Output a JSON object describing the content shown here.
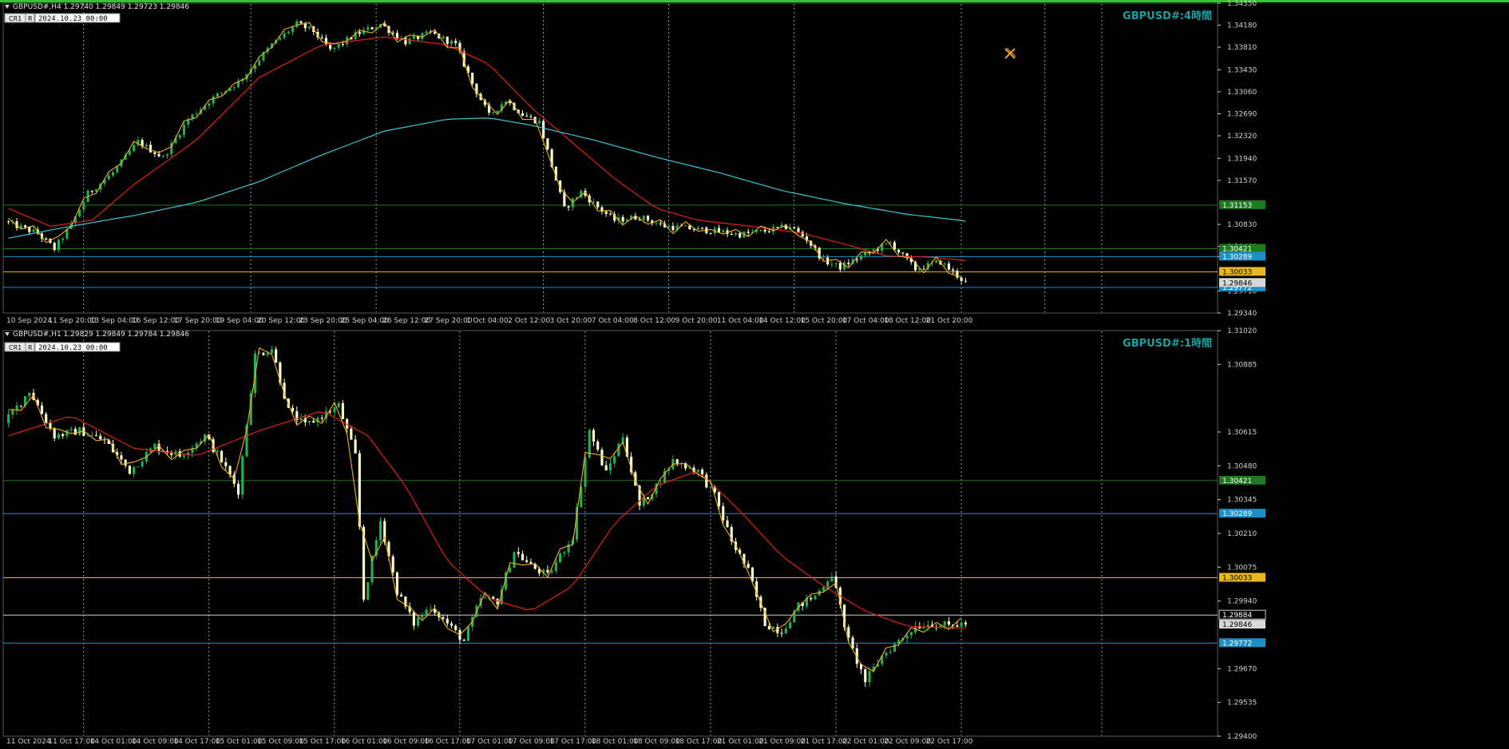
{
  "colors": {
    "background": "#000000",
    "bull": "#22b14c",
    "bear": "#ffffcc",
    "ma_fast": "#e0201a",
    "ma_slow": "#38c8d8",
    "zigzag": "#f0b020",
    "grid": "#c8c8c8",
    "axis_text": "#d0d0d0",
    "watermark": "#1aa0a0",
    "frame_top": "#2ec82e"
  },
  "icons": {
    "cursor": "crosshair-cursor-icon",
    "menu": "triangle-down-icon"
  },
  "chart_data": [
    {
      "type": "candlestick",
      "symbol_header": "GBPUSD#,H4  1.29740 1.29849 1.29723 1.29846",
      "watermark": "GBPUSD#:4時間",
      "toolbar": {
        "cr_label": "CR1",
        "r_label": "R",
        "date_value": "2024.10.23 00:00"
      },
      "ylim": [
        1.2934,
        1.3455
      ],
      "y_ticks": [
        "1.34550",
        "1.34180",
        "1.33810",
        "1.33430",
        "1.33060",
        "1.32690",
        "1.32320",
        "1.31940",
        "1.31570",
        "1.30830",
        "1.30460",
        "1.30289",
        "1.29710",
        "1.29340"
      ],
      "x_tick_labels": [
        "10 Sep 2024",
        "11 Sep 20:00",
        "13 Sep 04:00",
        "16 Sep 12:00",
        "17 Sep 20:00",
        "19 Sep 04:00",
        "20 Sep 12:00",
        "23 Sep 20:00",
        "25 Sep 04:00",
        "26 Sep 12:00",
        "27 Sep 20:00",
        "1 Oct 04:00",
        "2 Oct 12:00",
        "3 Oct 20:00",
        "7 Oct 04:00",
        "8 Oct 12:00",
        "9 Oct 20:00",
        "11 Oct 04:00",
        "14 Oct 12:00",
        "15 Oct 20:00",
        "17 Oct 04:00",
        "18 Oct 12:00",
        "21 Oct 20:00"
      ],
      "vgrid_after_tick": [
        2,
        6,
        9,
        13,
        16,
        19,
        23,
        25
      ],
      "n_bars": 230,
      "close_anchors": [
        [
          0,
          1.3088
        ],
        [
          8,
          1.3068
        ],
        [
          12,
          1.3042
        ],
        [
          16,
          1.3082
        ],
        [
          20,
          1.3135
        ],
        [
          26,
          1.317
        ],
        [
          32,
          1.3222
        ],
        [
          38,
          1.3195
        ],
        [
          44,
          1.326
        ],
        [
          50,
          1.3296
        ],
        [
          56,
          1.3322
        ],
        [
          64,
          1.3385
        ],
        [
          70,
          1.342
        ],
        [
          74,
          1.3408
        ],
        [
          78,
          1.3375
        ],
        [
          84,
          1.3402
        ],
        [
          90,
          1.342
        ],
        [
          96,
          1.339
        ],
        [
          102,
          1.3405
        ],
        [
          108,
          1.3385
        ],
        [
          112,
          1.332
        ],
        [
          116,
          1.3266
        ],
        [
          120,
          1.3292
        ],
        [
          124,
          1.3268
        ],
        [
          128,
          1.3255
        ],
        [
          134,
          1.3109
        ],
        [
          138,
          1.3138
        ],
        [
          142,
          1.3112
        ],
        [
          146,
          1.309
        ],
        [
          152,
          1.3096
        ],
        [
          158,
          1.308
        ],
        [
          164,
          1.3076
        ],
        [
          170,
          1.3072
        ],
        [
          176,
          1.3066
        ],
        [
          182,
          1.3072
        ],
        [
          188,
          1.308
        ],
        [
          192,
          1.3058
        ],
        [
          196,
          1.3022
        ],
        [
          200,
          1.3011
        ],
        [
          206,
          1.3033
        ],
        [
          212,
          1.3052
        ],
        [
          218,
          1.3008
        ],
        [
          224,
          1.302
        ],
        [
          230,
          1.2985
        ]
      ],
      "ma_fast_anchors": [
        [
          0,
          1.311
        ],
        [
          10,
          1.308
        ],
        [
          20,
          1.309
        ],
        [
          30,
          1.315
        ],
        [
          45,
          1.3225
        ],
        [
          60,
          1.333
        ],
        [
          75,
          1.3385
        ],
        [
          90,
          1.3398
        ],
        [
          105,
          1.3385
        ],
        [
          115,
          1.3352
        ],
        [
          125,
          1.328
        ],
        [
          135,
          1.322
        ],
        [
          145,
          1.316
        ],
        [
          155,
          1.311
        ],
        [
          165,
          1.309
        ],
        [
          180,
          1.3078
        ],
        [
          190,
          1.3068
        ],
        [
          200,
          1.305
        ],
        [
          210,
          1.303
        ],
        [
          220,
          1.3028
        ],
        [
          230,
          1.3022
        ]
      ],
      "ma_slow_anchors": [
        [
          0,
          1.306
        ],
        [
          15,
          1.308
        ],
        [
          30,
          1.3098
        ],
        [
          45,
          1.312
        ],
        [
          60,
          1.3155
        ],
        [
          75,
          1.32
        ],
        [
          90,
          1.324
        ],
        [
          105,
          1.326
        ],
        [
          115,
          1.3262
        ],
        [
          125,
          1.325
        ],
        [
          140,
          1.3225
        ],
        [
          155,
          1.3196
        ],
        [
          170,
          1.317
        ],
        [
          185,
          1.314
        ],
        [
          200,
          1.3118
        ],
        [
          215,
          1.31
        ],
        [
          230,
          1.3088
        ]
      ],
      "hlines": [
        {
          "price": 1.31155,
          "color": "#1e7a1e",
          "label": "1.31153",
          "label_bg": "#1e7a1e"
        },
        {
          "price": 1.30421,
          "color": "#1e7a1e",
          "label": "1.30421",
          "label_bg": "#1e7a1e"
        },
        {
          "price": 1.30289,
          "color": "#1e90c8",
          "label": "1.30289",
          "label_bg": "#1e90c8"
        },
        {
          "price": 1.30033,
          "color": "#e8b820",
          "label": "1.30033",
          "label_bg": "#e8b820"
        },
        {
          "price": 1.29772,
          "color": "#1e90c8",
          "label": "1.29772",
          "label_bg": "#1e90c8"
        }
      ],
      "price_labels": [
        {
          "price": 1.29846,
          "label": "1.29846",
          "label_bg": "#d8d8d8"
        }
      ]
    },
    {
      "type": "candlestick",
      "symbol_header": "GBPUSD#,H1  1.29829 1.29849 1.29784 1.29846",
      "watermark": "GBPUSD#:1時間",
      "toolbar": {
        "cr_label": "CR1",
        "r_label": "R",
        "date_value": "2024.10.23 00:00"
      },
      "ylim": [
        1.294,
        1.3102
      ],
      "y_ticks": [
        "1.31020",
        "1.30885",
        "1.30615",
        "1.30480",
        "1.30345",
        "1.30210",
        "1.30075",
        "1.29940",
        "1.29670",
        "1.29535",
        "1.29400"
      ],
      "x_tick_labels": [
        "11 Oct 2024",
        "11 Oct 17:00",
        "14 Oct 01:00",
        "14 Oct 09:00",
        "14 Oct 17:00",
        "15 Oct 01:00",
        "15 Oct 09:00",
        "15 Oct 17:00",
        "16 Oct 01:00",
        "16 Oct 09:00",
        "16 Oct 17:00",
        "17 Oct 01:00",
        "17 Oct 09:00",
        "17 Oct 17:00",
        "18 Oct 01:00",
        "18 Oct 09:00",
        "18 Oct 17:00",
        "21 Oct 01:00",
        "21 Oct 09:00",
        "21 Oct 17:00",
        "22 Oct 01:00",
        "22 Oct 09:00",
        "22 Oct 17:00"
      ],
      "vgrid_after_tick": [
        2,
        5,
        8,
        11,
        14,
        17,
        20,
        23
      ],
      "n_bars": 230,
      "close_anchors": [
        [
          0,
          1.3065
        ],
        [
          6,
          1.3078
        ],
        [
          12,
          1.306
        ],
        [
          18,
          1.3062
        ],
        [
          24,
          1.3058
        ],
        [
          30,
          1.3046
        ],
        [
          36,
          1.3056
        ],
        [
          42,
          1.3052
        ],
        [
          48,
          1.306
        ],
        [
          52,
          1.305
        ],
        [
          56,
          1.3038
        ],
        [
          60,
          1.3092
        ],
        [
          64,
          1.3095
        ],
        [
          68,
          1.307
        ],
        [
          72,
          1.3064
        ],
        [
          76,
          1.3068
        ],
        [
          80,
          1.3072
        ],
        [
          84,
          1.3052
        ],
        [
          86,
          1.2995
        ],
        [
          90,
          1.3026
        ],
        [
          94,
          1.2998
        ],
        [
          98,
          1.2985
        ],
        [
          102,
          1.2992
        ],
        [
          106,
          1.2985
        ],
        [
          110,
          1.2978
        ],
        [
          114,
          1.2995
        ],
        [
          118,
          1.2994
        ],
        [
          122,
          1.3014
        ],
        [
          126,
          1.3008
        ],
        [
          130,
          1.3004
        ],
        [
          136,
          1.302
        ],
        [
          140,
          1.3062
        ],
        [
          144,
          1.3045
        ],
        [
          148,
          1.306
        ],
        [
          152,
          1.3032
        ],
        [
          156,
          1.304
        ],
        [
          160,
          1.305
        ],
        [
          166,
          1.3046
        ],
        [
          170,
          1.3036
        ],
        [
          174,
          1.3018
        ],
        [
          178,
          1.3006
        ],
        [
          182,
          1.2985
        ],
        [
          186,
          1.2982
        ],
        [
          190,
          1.2992
        ],
        [
          194,
          1.2996
        ],
        [
          198,
          1.3005
        ],
        [
          202,
          1.2978
        ],
        [
          206,
          1.2962
        ],
        [
          210,
          1.2972
        ],
        [
          214,
          1.2978
        ],
        [
          218,
          1.2984
        ],
        [
          222,
          1.2985
        ],
        [
          226,
          1.2984
        ],
        [
          230,
          1.2985
        ]
      ],
      "ma_fast_anchors": [
        [
          0,
          1.306
        ],
        [
          15,
          1.3068
        ],
        [
          30,
          1.3055
        ],
        [
          45,
          1.3052
        ],
        [
          60,
          1.3062
        ],
        [
          75,
          1.307
        ],
        [
          86,
          1.306
        ],
        [
          95,
          1.304
        ],
        [
          105,
          1.301
        ],
        [
          115,
          1.2995
        ],
        [
          125,
          1.299
        ],
        [
          135,
          1.3
        ],
        [
          145,
          1.3025
        ],
        [
          155,
          1.304
        ],
        [
          165,
          1.3046
        ],
        [
          175,
          1.303
        ],
        [
          185,
          1.3012
        ],
        [
          195,
          1.3
        ],
        [
          205,
          1.299
        ],
        [
          215,
          1.2984
        ],
        [
          230,
          1.2983
        ]
      ],
      "hlines": [
        {
          "price": 1.30421,
          "color": "#1e7a1e",
          "label": "1.30421",
          "label_bg": "#1e7a1e"
        },
        {
          "price": 1.30289,
          "color": "#1e90c8",
          "label": "1.30289",
          "label_bg": "#1e90c8"
        },
        {
          "price": 1.30033,
          "color": "#e8b820",
          "label": "1.30033",
          "label_bg": "#e8b820"
        },
        {
          "price": 1.29884,
          "color": "#d0d0d0",
          "label": "1.29884",
          "label_bg": "#000000"
        },
        {
          "price": 1.29772,
          "color": "#1e90c8",
          "label": "1.29772",
          "label_bg": "#1e90c8"
        }
      ],
      "price_labels": [
        {
          "price": 1.29846,
          "label": "1.29846",
          "label_bg": "#d8d8d8"
        }
      ]
    }
  ]
}
